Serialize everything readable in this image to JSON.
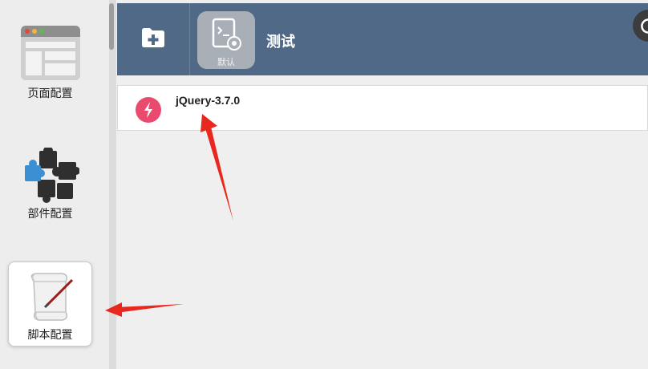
{
  "sidebar": {
    "items": [
      {
        "label": "页面配置",
        "icon": "browser-window-icon",
        "active": false
      },
      {
        "label": "部件配置",
        "icon": "puzzle-pieces-icon",
        "active": false
      },
      {
        "label": "脚本配置",
        "icon": "script-scroll-icon",
        "active": true
      }
    ]
  },
  "toolbar": {
    "new_folder_icon": "folder-add-icon",
    "profile": {
      "badge_label": "默认",
      "name": "测试",
      "icon": "script-settings-icon"
    },
    "refresh_icon": "refresh-icon"
  },
  "scripts": [
    {
      "name": "jQuery-3.7.0",
      "icon": "script-link-icon",
      "icon_color": "#e94a6e"
    }
  ],
  "colors": {
    "toolbar_bg": "#4f6986",
    "arrow": "#e8281e",
    "sidebar_bg": "#ededed"
  }
}
